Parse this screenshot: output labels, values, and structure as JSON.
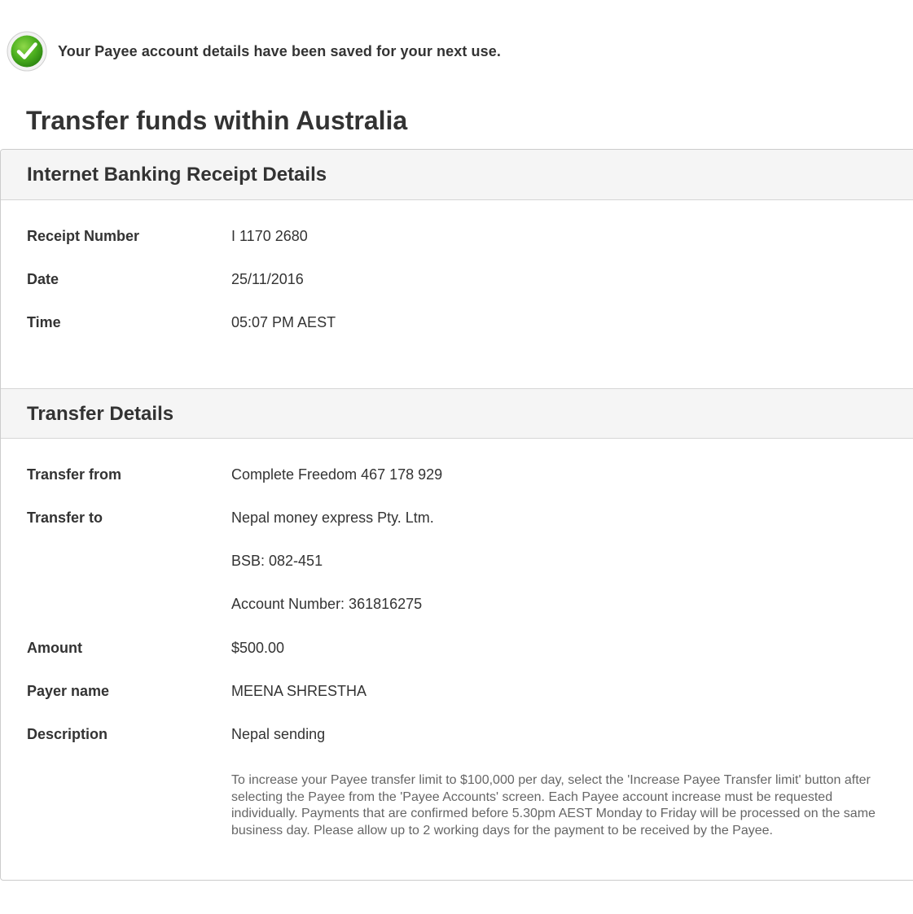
{
  "notice": {
    "text": "Your Payee account details have been saved for your next use.",
    "icon": "check-circle-icon",
    "icon_color": "#4caf1f"
  },
  "page_title": "Transfer funds within Australia",
  "receipt_section": {
    "title": "Internet Banking Receipt Details",
    "rows": [
      {
        "label": "Receipt Number",
        "value": "I 1170 2680"
      },
      {
        "label": "Date",
        "value": "25/11/2016"
      },
      {
        "label": "Time",
        "value": "05:07 PM AEST"
      }
    ]
  },
  "transfer_section": {
    "title": "Transfer Details",
    "rows": [
      {
        "label": "Transfer from",
        "value": "Complete Freedom 467 178 929"
      },
      {
        "label": "Transfer to",
        "value": "Nepal money express Pty. Ltm."
      },
      {
        "label": "",
        "value": "BSB: 082-451"
      },
      {
        "label": "",
        "value": "Account Number: 361816275"
      },
      {
        "label": "Amount",
        "value": "$500.00"
      },
      {
        "label": "Payer name",
        "value": "MEENA SHRESTHA"
      },
      {
        "label": "Description",
        "value": "Nepal sending"
      }
    ],
    "footnote": "To increase your Payee transfer limit to $100,000 per day, select the 'Increase Payee Transfer limit' button after selecting the Payee from the 'Payee Accounts' screen. Each Payee account increase must be requested individually.  Payments that are confirmed before 5.30pm AEST Monday to Friday will be processed on the same business day. Please allow up to 2 working days for the payment to be received by the Payee."
  }
}
